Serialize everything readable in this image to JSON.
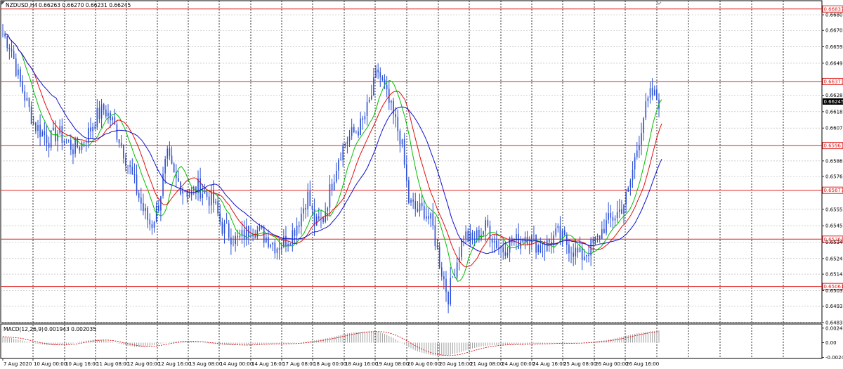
{
  "header": {
    "symbol": "NZDUSD,H4",
    "ohlc": "0.66263 0.66270 0.66231 0.66245"
  },
  "macd_header": {
    "label": "MACD(12,26,9)",
    "values": "0.001943 0.002035"
  },
  "colors": {
    "candles": "#2a4fd6",
    "ma_fast": "#00c000",
    "ma_mid": "#e01010",
    "ma_slow": "#1010d0",
    "level_line": "#e02020",
    "macd_hist": "#a0a0a0",
    "macd_signal": "#d01010",
    "current_price_bg": "#000000"
  },
  "chart_data": [
    {
      "type": "candlestick",
      "symbol": "NZDUSD",
      "timeframe": "H4",
      "ylim": [
        0.6483,
        0.6689
      ],
      "y_ticks": [
        "0.66800",
        "0.66700",
        "0.66595",
        "0.66490",
        "0.66285",
        "0.66180",
        "0.66075",
        "0.65865",
        "0.65765",
        "0.65555",
        "0.65450",
        "0.65345",
        "0.65240",
        "0.65140",
        "0.65035",
        "0.64935",
        "0.64830"
      ],
      "x_ticks": [
        "7 Aug 2020",
        "10 Aug 00:00",
        "10 Aug 16:00",
        "11 Aug 08:00",
        "12 Aug 00:00",
        "12 Aug 16:00",
        "13 Aug 08:00",
        "14 Aug 00:00",
        "14 Aug 16:00",
        "17 Aug 08:00",
        "18 Aug 00:00",
        "18 Aug 16:00",
        "19 Aug 08:00",
        "20 Aug 00:00",
        "20 Aug 16:00",
        "21 Aug 08:00",
        "24 Aug 00:00",
        "24 Aug 16:00",
        "25 Aug 08:00",
        "26 Aug 00:00",
        "26 Aug 16:00"
      ],
      "levels": [
        "0.66837",
        "0.66373",
        "0.65963",
        "0.65677",
        "0.65364",
        "0.65061"
      ],
      "current_price": "0.66245",
      "close_path": [
        0.6668,
        0.666,
        0.664,
        0.6625,
        0.661,
        0.6605,
        0.66,
        0.6605,
        0.66,
        0.6595,
        0.6597,
        0.6605,
        0.6615,
        0.662,
        0.6612,
        0.66,
        0.6585,
        0.657,
        0.6555,
        0.6545,
        0.656,
        0.659,
        0.6575,
        0.657,
        0.6565,
        0.657,
        0.6565,
        0.656,
        0.6545,
        0.654,
        0.6535,
        0.654,
        0.6545,
        0.654,
        0.6537,
        0.6532,
        0.6535,
        0.654,
        0.655,
        0.6565,
        0.6545,
        0.655,
        0.657,
        0.659,
        0.66,
        0.6605,
        0.661,
        0.6625,
        0.6645,
        0.663,
        0.6615,
        0.66,
        0.656,
        0.6555,
        0.6555,
        0.6545,
        0.652,
        0.65,
        0.652,
        0.654,
        0.6535,
        0.654,
        0.6545,
        0.6535,
        0.653,
        0.6535,
        0.6535,
        0.654,
        0.6535,
        0.653,
        0.6535,
        0.654,
        0.6535,
        0.653,
        0.6525,
        0.653,
        0.6535,
        0.6545,
        0.655,
        0.6555,
        0.6565,
        0.659,
        0.6615,
        0.663,
        0.6625
      ],
      "moving_averages": [
        "fast",
        "mid",
        "slow"
      ]
    },
    {
      "type": "macd",
      "label": "MACD(12,26,9)",
      "main": 0.001943,
      "signal": 0.002035,
      "y_ticks": [
        "0.002401",
        "0.00",
        "-0.00243"
      ],
      "hist_path": [
        0.001,
        0.0008,
        0.0005,
        0.0002,
        -0.0001,
        -0.0003,
        -0.0004,
        -0.0004,
        -0.0003,
        -0.0001,
        0.0002,
        0.0004,
        0.0005,
        0.0004,
        0.0001,
        -0.0002,
        -0.0005,
        -0.0007,
        -0.0007,
        -0.0005,
        -0.0002,
        0.0,
        0.0002,
        0.0003,
        0.0002,
        0.0001,
        -0.0001,
        -0.0002,
        -0.0003,
        -0.0004,
        -0.0004,
        -0.0004,
        -0.0003,
        -0.0002,
        -0.0002,
        -0.0002,
        -0.0002,
        -0.0001,
        0.0,
        0.0002,
        0.0004,
        0.0006,
        0.0009,
        0.0012,
        0.0015,
        0.0017,
        0.0018,
        0.0019,
        0.0018,
        0.0014,
        0.0008,
        0.0,
        -0.0008,
        -0.0014,
        -0.0018,
        -0.0021,
        -0.0022,
        -0.0021,
        -0.0018,
        -0.0014,
        -0.001,
        -0.0007,
        -0.0005,
        -0.0004,
        -0.0003,
        -0.0003,
        -0.0003,
        -0.0002,
        -0.0002,
        -0.0002,
        -0.0001,
        -0.0001,
        -0.0001,
        -0.0001,
        0.0,
        0.0001,
        0.0002,
        0.0004,
        0.0006,
        0.0009,
        0.0012,
        0.0015,
        0.0017,
        0.0019,
        0.002
      ]
    }
  ]
}
